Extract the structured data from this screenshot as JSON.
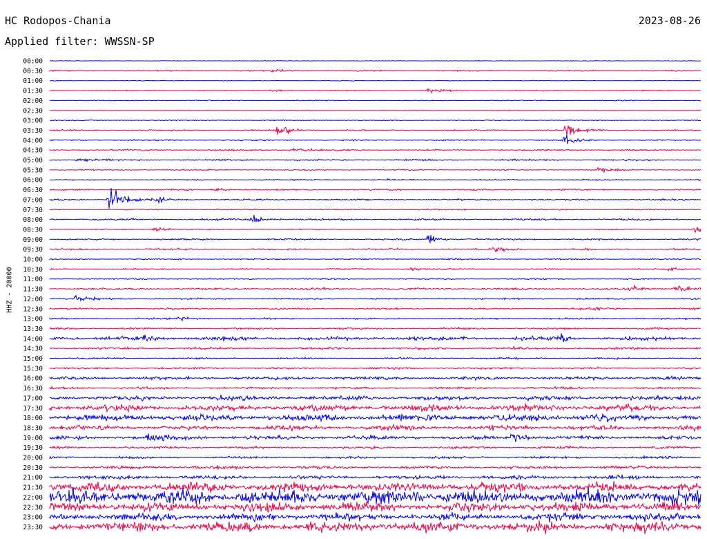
{
  "header": {
    "station": "HC Rodopos-Chania",
    "date": "2023-08-26",
    "filter": "Applied filter: WWSSN-SP"
  },
  "chart_data": {
    "type": "line",
    "title": "HC Rodopos-Chania",
    "ylabel": "HHZ - 20000",
    "colors": {
      "even": "#0000ee",
      "odd": "#ee0044"
    },
    "rows": [
      {
        "time": "00:00",
        "a": 0.4,
        "events": []
      },
      {
        "time": "00:30",
        "a": 0.8,
        "events": [
          [
            0.34,
            1.5
          ]
        ]
      },
      {
        "time": "01:00",
        "a": 0.4,
        "events": []
      },
      {
        "time": "01:30",
        "a": 0.7,
        "events": [
          [
            0.34,
            1.6
          ],
          [
            0.58,
            2.5
          ]
        ]
      },
      {
        "time": "02:00",
        "a": 0.6,
        "events": []
      },
      {
        "time": "02:30",
        "a": 0.4,
        "events": []
      },
      {
        "time": "03:00",
        "a": 0.5,
        "events": []
      },
      {
        "time": "03:30",
        "a": 0.8,
        "events": [
          [
            0.35,
            7
          ],
          [
            0.79,
            12
          ]
        ]
      },
      {
        "time": "04:00",
        "a": 0.8,
        "events": [
          [
            0.79,
            6
          ]
        ]
      },
      {
        "time": "04:30",
        "a": 1.0,
        "events": [
          [
            0.37,
            3
          ]
        ]
      },
      {
        "time": "05:00",
        "a": 1.0,
        "events": [
          [
            0.04,
            2
          ]
        ]
      },
      {
        "time": "05:30",
        "a": 0.8,
        "events": [
          [
            0.84,
            4
          ]
        ]
      },
      {
        "time": "06:00",
        "a": 0.8,
        "events": []
      },
      {
        "time": "06:30",
        "a": 1.0,
        "events": [
          [
            0.25,
            2
          ]
        ]
      },
      {
        "time": "07:00",
        "a": 1.0,
        "events": [
          [
            0.09,
            20
          ],
          [
            0.16,
            4
          ]
        ]
      },
      {
        "time": "07:30",
        "a": 0.8,
        "events": []
      },
      {
        "time": "08:00",
        "a": 1.2,
        "events": [
          [
            0.31,
            4
          ]
        ]
      },
      {
        "time": "08:30",
        "a": 0.7,
        "events": [
          [
            0.16,
            3
          ],
          [
            0.99,
            6
          ]
        ]
      },
      {
        "time": "09:00",
        "a": 1.0,
        "events": [
          [
            0.58,
            5
          ]
        ]
      },
      {
        "time": "09:30",
        "a": 1.2,
        "events": [
          [
            0.68,
            4
          ]
        ]
      },
      {
        "time": "10:00",
        "a": 0.8,
        "events": []
      },
      {
        "time": "10:30",
        "a": 0.8,
        "events": [
          [
            0.55,
            2
          ],
          [
            0.95,
            2
          ]
        ]
      },
      {
        "time": "11:00",
        "a": 0.8,
        "events": []
      },
      {
        "time": "11:30",
        "a": 1.2,
        "events": [
          [
            0.89,
            4
          ],
          [
            0.96,
            5
          ]
        ]
      },
      {
        "time": "12:00",
        "a": 1.0,
        "events": [
          [
            0.04,
            3
          ]
        ]
      },
      {
        "time": "12:30",
        "a": 1.0,
        "events": [
          [
            0.83,
            3
          ]
        ]
      },
      {
        "time": "13:00",
        "a": 1.0,
        "events": [
          [
            0.2,
            2
          ]
        ]
      },
      {
        "time": "13:30",
        "a": 1.2,
        "events": []
      },
      {
        "time": "14:00",
        "a": 2.5,
        "events": [
          [
            0.14,
            3
          ],
          [
            0.78,
            3
          ]
        ]
      },
      {
        "time": "14:30",
        "a": 1.5,
        "events": []
      },
      {
        "time": "15:00",
        "a": 1.0,
        "events": []
      },
      {
        "time": "15:30",
        "a": 1.2,
        "events": []
      },
      {
        "time": "16:00",
        "a": 2.0,
        "events": []
      },
      {
        "time": "16:30",
        "a": 1.5,
        "events": []
      },
      {
        "time": "17:00",
        "a": 2.8,
        "events": [
          [
            0.97,
            3
          ]
        ]
      },
      {
        "time": "17:30",
        "a": 4.0,
        "events": []
      },
      {
        "time": "18:00",
        "a": 4.5,
        "events": []
      },
      {
        "time": "18:30",
        "a": 3.0,
        "events": []
      },
      {
        "time": "19:00",
        "a": 2.5,
        "events": [
          [
            0.15,
            6
          ],
          [
            0.71,
            6
          ]
        ]
      },
      {
        "time": "19:30",
        "a": 1.5,
        "events": []
      },
      {
        "time": "20:00",
        "a": 1.5,
        "events": []
      },
      {
        "time": "20:30",
        "a": 2.0,
        "events": []
      },
      {
        "time": "21:00",
        "a": 2.5,
        "events": []
      },
      {
        "time": "21:30",
        "a": 6.0,
        "events": []
      },
      {
        "time": "22:00",
        "a": 9.0,
        "events": []
      },
      {
        "time": "22:30",
        "a": 6.0,
        "events": []
      },
      {
        "time": "23:00",
        "a": 5.0,
        "events": []
      },
      {
        "time": "23:30",
        "a": 6.5,
        "events": []
      }
    ]
  }
}
